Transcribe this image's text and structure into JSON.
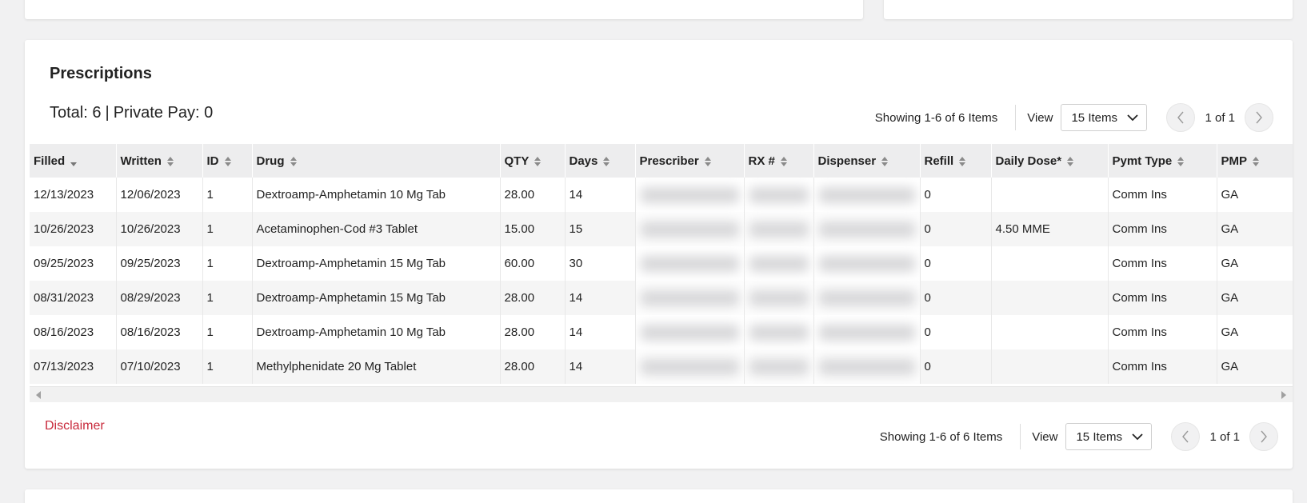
{
  "section": {
    "title": "Prescriptions",
    "total_label": "Total: 6",
    "private_pay_label": "Private Pay: 0",
    "separator": "|"
  },
  "pager_top": {
    "showing": "Showing 1-6 of 6 Items",
    "view_label": "View",
    "items_per_page": "15 Items",
    "page_info": "1 of 1"
  },
  "pager_bottom": {
    "showing": "Showing 1-6 of 6 Items",
    "view_label": "View",
    "items_per_page": "15 Items",
    "page_info": "1 of 1"
  },
  "table": {
    "headers": [
      "Filled",
      "Written",
      "ID",
      "Drug",
      "QTY",
      "Days",
      "Prescriber",
      "RX #",
      "Dispenser",
      "Refill",
      "Daily Dose*",
      "Pymt Type",
      "PMP"
    ],
    "rows": [
      {
        "filled": "12/13/2023",
        "written": "12/06/2023",
        "id": "1",
        "drug": "Dextroamp-Amphetamin 10 Mg Tab",
        "qty": "28.00",
        "days": "14",
        "refill": "0",
        "daily_dose": "",
        "pymt_type": "Comm Ins",
        "pmp": "GA"
      },
      {
        "filled": "10/26/2023",
        "written": "10/26/2023",
        "id": "1",
        "drug": "Acetaminophen-Cod #3 Tablet",
        "qty": "15.00",
        "days": "15",
        "refill": "0",
        "daily_dose": "4.50 MME",
        "pymt_type": "Comm Ins",
        "pmp": "GA"
      },
      {
        "filled": "09/25/2023",
        "written": "09/25/2023",
        "id": "1",
        "drug": "Dextroamp-Amphetamin 15 Mg Tab",
        "qty": "60.00",
        "days": "30",
        "refill": "0",
        "daily_dose": "",
        "pymt_type": "Comm Ins",
        "pmp": "GA"
      },
      {
        "filled": "08/31/2023",
        "written": "08/29/2023",
        "id": "1",
        "drug": "Dextroamp-Amphetamin 15 Mg Tab",
        "qty": "28.00",
        "days": "14",
        "refill": "0",
        "daily_dose": "",
        "pymt_type": "Comm Ins",
        "pmp": "GA"
      },
      {
        "filled": "08/16/2023",
        "written": "08/16/2023",
        "id": "1",
        "drug": "Dextroamp-Amphetamin 10 Mg Tab",
        "qty": "28.00",
        "days": "14",
        "refill": "0",
        "daily_dose": "",
        "pymt_type": "Comm Ins",
        "pmp": "GA"
      },
      {
        "filled": "07/13/2023",
        "written": "07/10/2023",
        "id": "1",
        "drug": "Methylphenidate 20 Mg Tablet",
        "qty": "28.00",
        "days": "14",
        "refill": "0",
        "daily_dose": "",
        "pymt_type": "Comm Ins",
        "pmp": "GA"
      }
    ]
  },
  "footer": {
    "disclaimer": "Disclaimer"
  },
  "colors": {
    "disclaimer_link": "#c8293b",
    "header_bg": "#ededee"
  }
}
